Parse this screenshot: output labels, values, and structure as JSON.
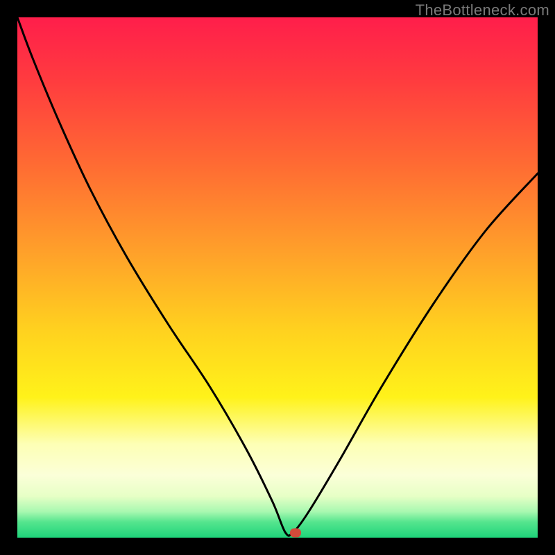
{
  "watermark": "TheBottleneck.com",
  "chart_data": {
    "type": "line",
    "title": "",
    "xlabel": "",
    "ylabel": "",
    "xlim": [
      0,
      100
    ],
    "ylim": [
      0,
      100
    ],
    "gradient_stops": [
      {
        "offset": 0,
        "color": "#ff1e4b"
      },
      {
        "offset": 12,
        "color": "#ff3b3f"
      },
      {
        "offset": 28,
        "color": "#ff6a33"
      },
      {
        "offset": 45,
        "color": "#ffa02a"
      },
      {
        "offset": 60,
        "color": "#ffd11f"
      },
      {
        "offset": 73,
        "color": "#fff21a"
      },
      {
        "offset": 82,
        "color": "#fdffb5"
      },
      {
        "offset": 88,
        "color": "#fbffd8"
      },
      {
        "offset": 92,
        "color": "#e7ffc6"
      },
      {
        "offset": 95,
        "color": "#a8f8b0"
      },
      {
        "offset": 97,
        "color": "#55e58e"
      },
      {
        "offset": 100,
        "color": "#1ed47a"
      }
    ],
    "series": [
      {
        "name": "curve",
        "x": [
          0,
          3,
          8,
          14,
          21,
          29,
          37,
          44,
          49,
          51.5,
          53,
          56,
          62,
          70,
          80,
          90,
          100
        ],
        "y": [
          100,
          92,
          80,
          67,
          54,
          41,
          29,
          17,
          7,
          1,
          1,
          5,
          15,
          29,
          45,
          59,
          70
        ]
      }
    ],
    "marker": {
      "x": 53.5,
      "y": 1,
      "color": "#d24a3a"
    }
  }
}
